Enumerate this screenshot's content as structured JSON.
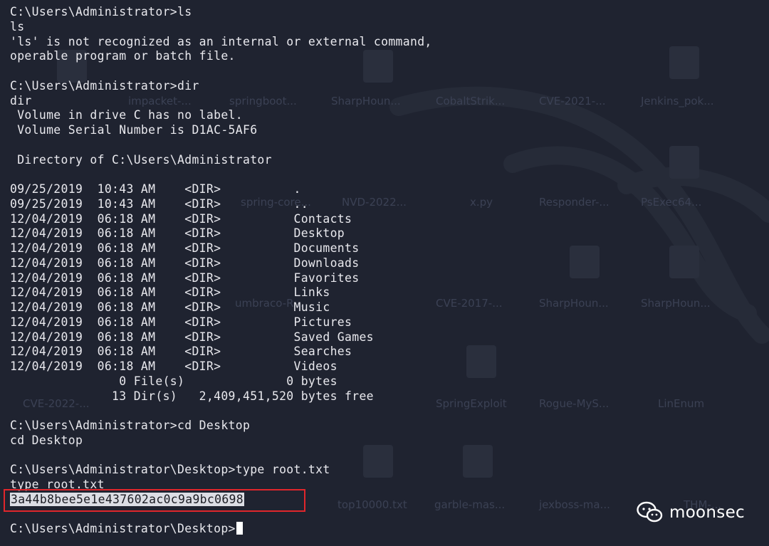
{
  "terminal": {
    "lines": [
      "C:\\Users\\Administrator>ls",
      "ls",
      "'ls' is not recognized as an internal or external command,",
      "operable program or batch file.",
      "",
      "C:\\Users\\Administrator>dir",
      "dir",
      " Volume in drive C has no label.",
      " Volume Serial Number is D1AC-5AF6",
      "",
      " Directory of C:\\Users\\Administrator",
      "",
      "09/25/2019  10:43 AM    <DIR>          .",
      "09/25/2019  10:43 AM    <DIR>          ..",
      "12/04/2019  06:18 AM    <DIR>          Contacts",
      "12/04/2019  06:18 AM    <DIR>          Desktop",
      "12/04/2019  06:18 AM    <DIR>          Documents",
      "12/04/2019  06:18 AM    <DIR>          Downloads",
      "12/04/2019  06:18 AM    <DIR>          Favorites",
      "12/04/2019  06:18 AM    <DIR>          Links",
      "12/04/2019  06:18 AM    <DIR>          Music",
      "12/04/2019  06:18 AM    <DIR>          Pictures",
      "12/04/2019  06:18 AM    <DIR>          Saved Games",
      "12/04/2019  06:18 AM    <DIR>          Searches",
      "12/04/2019  06:18 AM    <DIR>          Videos",
      "               0 File(s)              0 bytes",
      "              13 Dir(s)   2,409,451,520 bytes free",
      "",
      "C:\\Users\\Administrator>cd Desktop",
      "cd Desktop",
      "",
      "C:\\Users\\Administrator\\Desktop>type root.txt",
      "type root.txt"
    ],
    "flag": "3a44b8bee5e1e437602ac0c9a9bc0698",
    "prompt": "C:\\Users\\Administrator\\Desktop>"
  },
  "desktop_labels": [
    "SharpHoun...",
    "CobaltStrik...",
    "CVE-2021-...",
    "Jenkins_pok...",
    "impacket-...",
    "springboot...",
    "spring-core...",
    "NVD-2022...",
    "x.py",
    "Responder-...",
    "PsExec64...",
    "CVE-2017-...",
    "SharpHoun...",
    "SharpHoun...",
    "umbraco-R...",
    "CVE-2022-...",
    "SpringExploit",
    "Rogue-MyS...",
    "LinEnum",
    "top10000.txt",
    "garble-mas...",
    "jexboss-ma...",
    "THM-..."
  ],
  "watermark": {
    "text": "moonsec",
    "icon": "wechat-icon"
  },
  "colors": {
    "background": "#1f2330",
    "text": "#e9e9ee",
    "highlight_box": "#e0262b"
  }
}
